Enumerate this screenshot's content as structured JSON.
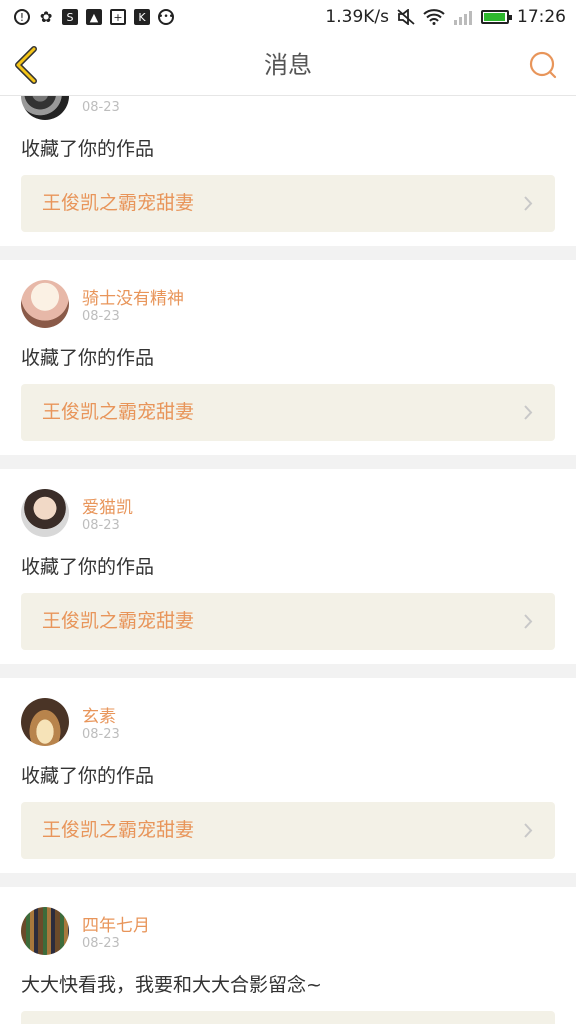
{
  "status_bar": {
    "left_icons": [
      "alarm-icon",
      "paw-icon",
      "s-app-icon",
      "image-icon",
      "plus-app-icon",
      "k-app-icon",
      "more-icon"
    ],
    "speed": "1.39K/s",
    "time": "17:26",
    "battery_level": 0.95,
    "colors": {
      "battery": "#2eb82e"
    }
  },
  "nav": {
    "title": "消息",
    "back_icon": "chevron-left-icon",
    "search_icon": "search-icon"
  },
  "colors": {
    "accent": "#e8955a",
    "link_bg": "#f3f1e7",
    "nav_back": "#f5c518"
  },
  "messages": [
    {
      "user": "",
      "time": "08-23",
      "action": "收藏了你的作品",
      "work": "王俊凯之霸宠甜妻"
    },
    {
      "user": "骑士没有精神",
      "time": "08-23",
      "action": "收藏了你的作品",
      "work": "王俊凯之霸宠甜妻"
    },
    {
      "user": "爱猫凯",
      "time": "08-23",
      "action": "收藏了你的作品",
      "work": "王俊凯之霸宠甜妻"
    },
    {
      "user": "玄素",
      "time": "08-23",
      "action": "收藏了你的作品",
      "work": "王俊凯之霸宠甜妻"
    },
    {
      "user": "四年七月",
      "time": "08-23",
      "action": "大大快看我，我要和大大合影留念~",
      "work": ""
    }
  ]
}
